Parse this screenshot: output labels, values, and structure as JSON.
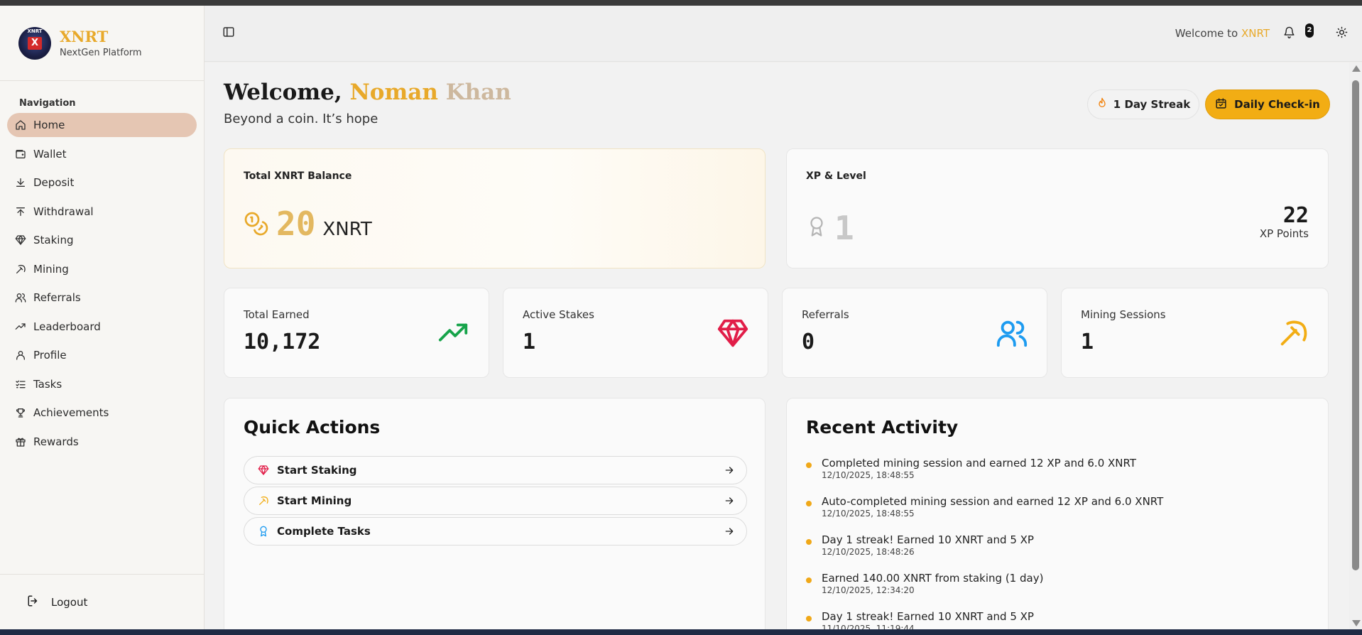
{
  "brand": {
    "name": "XNRT",
    "subtitle": "NextGen Platform",
    "logo_text": "XNRT",
    "logo_mark": "X"
  },
  "sidebar": {
    "heading": "Navigation",
    "items": [
      {
        "label": "Home",
        "icon": "home-icon",
        "active": true
      },
      {
        "label": "Wallet",
        "icon": "wallet-icon"
      },
      {
        "label": "Deposit",
        "icon": "download-icon"
      },
      {
        "label": "Withdrawal",
        "icon": "upload-icon"
      },
      {
        "label": "Staking",
        "icon": "gem-icon"
      },
      {
        "label": "Mining",
        "icon": "pickaxe-icon"
      },
      {
        "label": "Referrals",
        "icon": "users-icon"
      },
      {
        "label": "Leaderboard",
        "icon": "trending-up-icon"
      },
      {
        "label": "Profile",
        "icon": "user-icon"
      },
      {
        "label": "Tasks",
        "icon": "list-checks-icon"
      },
      {
        "label": "Achievements",
        "icon": "trophy-icon"
      },
      {
        "label": "Rewards",
        "icon": "gift-icon"
      }
    ],
    "logout": "Logout"
  },
  "header": {
    "welcome_prefix": "Welcome to",
    "welcome_brand": "XNRT",
    "notification_count": "2"
  },
  "welcome": {
    "greeting": "Welcome, ",
    "name_first": "Noman",
    "name_last": " Khan",
    "tagline": "Beyond a coin. It’s hope",
    "streak_label": "1 Day Streak",
    "checkin_label": "Daily Check-in"
  },
  "balance": {
    "label": "Total XNRT Balance",
    "value": "20",
    "unit": "XNRT"
  },
  "xp": {
    "label": "XP & Level",
    "level": "1",
    "points": "22",
    "points_label": "XP Points"
  },
  "stats": [
    {
      "label": "Total Earned",
      "value": "10,172",
      "icon": "trending-up-icon",
      "color": "#16a34a"
    },
    {
      "label": "Active Stakes",
      "value": "1",
      "icon": "gem-icon",
      "color": "#e11d48"
    },
    {
      "label": "Referrals",
      "value": "0",
      "icon": "users-icon",
      "color": "#1d9bf0"
    },
    {
      "label": "Mining Sessions",
      "value": "1",
      "icon": "pickaxe-icon",
      "color": "#f2ad14"
    }
  ],
  "quick_actions": {
    "title": "Quick Actions",
    "items": [
      {
        "label": "Start Staking",
        "icon": "gem-icon"
      },
      {
        "label": "Start Mining",
        "icon": "pickaxe-icon"
      },
      {
        "label": "Complete Tasks",
        "icon": "award-icon"
      }
    ]
  },
  "recent_activity": {
    "title": "Recent Activity",
    "items": [
      {
        "text": "Completed mining session and earned 12 XP and 6.0 XNRT",
        "time": "12/10/2025, 18:48:55"
      },
      {
        "text": "Auto-completed mining session and earned 12 XP and 6.0 XNRT",
        "time": "12/10/2025, 18:48:55"
      },
      {
        "text": "Day 1 streak! Earned 10 XNRT and 5 XP",
        "time": "12/10/2025, 18:48:26"
      },
      {
        "text": "Earned 140.00 XNRT from staking (1 day)",
        "time": "12/10/2025, 12:34:20"
      },
      {
        "text": "Day 1 streak! Earned 10 XNRT and 5 XP",
        "time": "11/10/2025, 11:19:44"
      }
    ]
  },
  "colors": {
    "accent": "#f2ad14",
    "brand": "#e8a92a",
    "active_nav": "#e5c6b3"
  }
}
